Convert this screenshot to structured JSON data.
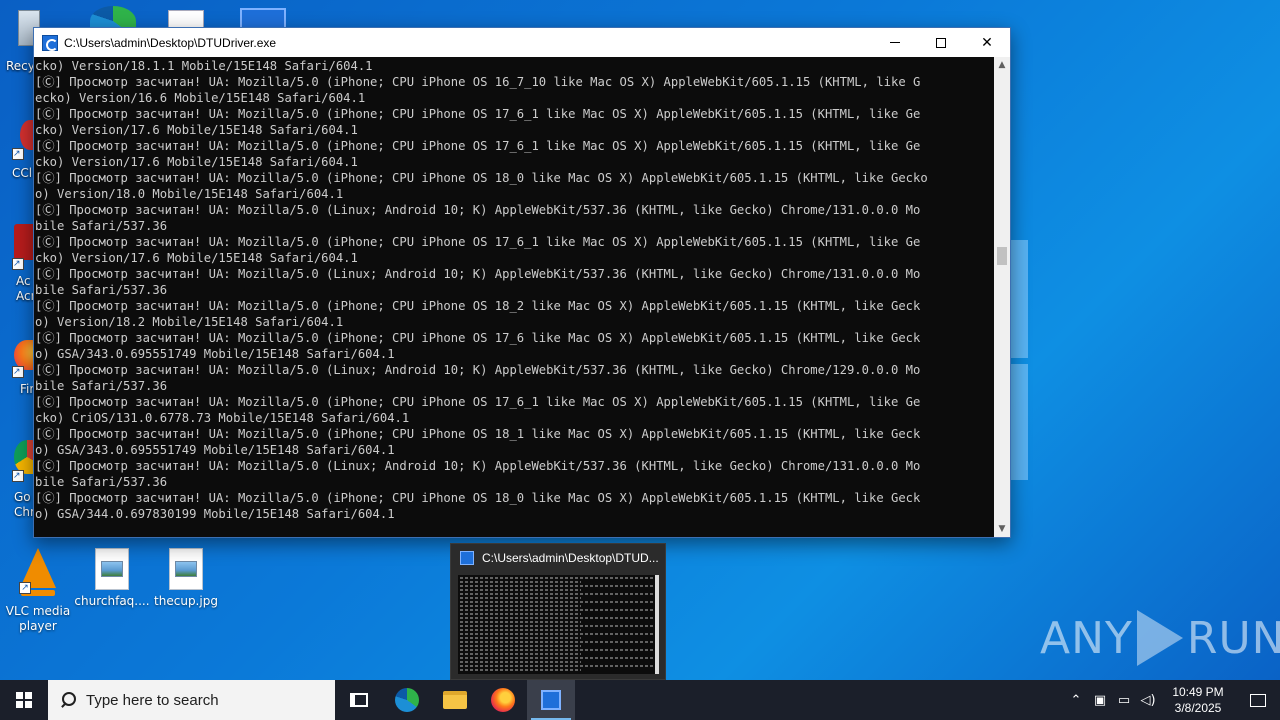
{
  "desktop": {
    "icons": [
      {
        "label": "VLC media player"
      },
      {
        "label": "churchfaq...."
      },
      {
        "label": "thecup.jpg"
      }
    ],
    "edge_labels": [
      "Recycle",
      "CCl",
      "Ac Acr",
      "Fir",
      "Go Chr"
    ]
  },
  "console": {
    "title": "C:\\Users\\admin\\Desktop\\DTUDriver.exe",
    "lines": [
      "cko) Version/18.1.1 Mobile/15E148 Safari/604.1",
      "[Ⓒ] Просмотр засчитан! UA: Mozilla/5.0 (iPhone; CPU iPhone OS 16_7_10 like Mac OS X) AppleWebKit/605.1.15 (KHTML, like G",
      "ecko) Version/16.6 Mobile/15E148 Safari/604.1",
      "[Ⓒ] Просмотр засчитан! UA: Mozilla/5.0 (iPhone; CPU iPhone OS 17_6_1 like Mac OS X) AppleWebKit/605.1.15 (KHTML, like Ge",
      "cko) Version/17.6 Mobile/15E148 Safari/604.1",
      "[Ⓒ] Просмотр засчитан! UA: Mozilla/5.0 (iPhone; CPU iPhone OS 17_6_1 like Mac OS X) AppleWebKit/605.1.15 (KHTML, like Ge",
      "cko) Version/17.6 Mobile/15E148 Safari/604.1",
      "[Ⓒ] Просмотр засчитан! UA: Mozilla/5.0 (iPhone; CPU iPhone OS 18_0 like Mac OS X) AppleWebKit/605.1.15 (KHTML, like Gecko",
      "o) Version/18.0 Mobile/15E148 Safari/604.1",
      "[Ⓒ] Просмотр засчитан! UA: Mozilla/5.0 (Linux; Android 10; K) AppleWebKit/537.36 (KHTML, like Gecko) Chrome/131.0.0.0 Mo",
      "bile Safari/537.36",
      "[Ⓒ] Просмотр засчитан! UA: Mozilla/5.0 (iPhone; CPU iPhone OS 17_6_1 like Mac OS X) AppleWebKit/605.1.15 (KHTML, like Ge",
      "cko) Version/17.6 Mobile/15E148 Safari/604.1",
      "[Ⓒ] Просмотр засчитан! UA: Mozilla/5.0 (Linux; Android 10; K) AppleWebKit/537.36 (KHTML, like Gecko) Chrome/131.0.0.0 Mo",
      "bile Safari/537.36",
      "[Ⓒ] Просмотр засчитан! UA: Mozilla/5.0 (iPhone; CPU iPhone OS 18_2 like Mac OS X) AppleWebKit/605.1.15 (KHTML, like Geck",
      "o) Version/18.2 Mobile/15E148 Safari/604.1",
      "[Ⓒ] Просмотр засчитан! UA: Mozilla/5.0 (iPhone; CPU iPhone OS 17_6 like Mac OS X) AppleWebKit/605.1.15 (KHTML, like Geck",
      "o) GSA/343.0.695551749 Mobile/15E148 Safari/604.1",
      "[Ⓒ] Просмотр засчитан! UA: Mozilla/5.0 (Linux; Android 10; K) AppleWebKit/537.36 (KHTML, like Gecko) Chrome/129.0.0.0 Mo",
      "bile Safari/537.36",
      "[Ⓒ] Просмотр засчитан! UA: Mozilla/5.0 (iPhone; CPU iPhone OS 17_6_1 like Mac OS X) AppleWebKit/605.1.15 (KHTML, like Ge",
      "cko) CriOS/131.0.6778.73 Mobile/15E148 Safari/604.1",
      "[Ⓒ] Просмотр засчитан! UA: Mozilla/5.0 (iPhone; CPU iPhone OS 18_1 like Mac OS X) AppleWebKit/605.1.15 (KHTML, like Geck",
      "o) GSA/343.0.695551749 Mobile/15E148 Safari/604.1",
      "[Ⓒ] Просмотр засчитан! UA: Mozilla/5.0 (Linux; Android 10; K) AppleWebKit/537.36 (KHTML, like Gecko) Chrome/131.0.0.0 Mo",
      "bile Safari/537.36",
      "[Ⓒ] Просмотр засчитан! UA: Mozilla/5.0 (iPhone; CPU iPhone OS 18_0 like Mac OS X) AppleWebKit/605.1.15 (KHTML, like Geck",
      "o) GSA/344.0.697830199 Mobile/15E148 Safari/604.1"
    ]
  },
  "preview": {
    "title": "C:\\Users\\admin\\Desktop\\DTUD..."
  },
  "watermark": {
    "text_left": "ANY",
    "text_right": "RUN"
  },
  "taskbar": {
    "search_placeholder": "Type here to search",
    "time": "10:49 PM",
    "date": "3/8/2025"
  },
  "colors": {
    "console_bg": "#0c0c0c",
    "console_fg": "#cccccc",
    "taskbar_bg": "#1b1f2a",
    "accent": "#76b9ed"
  }
}
